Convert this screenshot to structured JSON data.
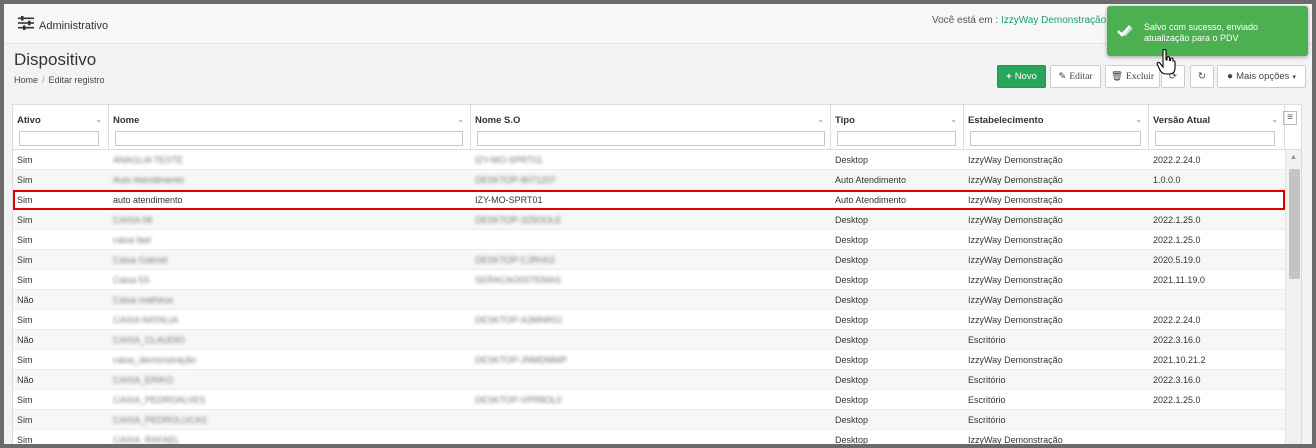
{
  "header": {
    "app_title": "Administrativo",
    "where_label": "Você está em :",
    "where_value": "IzzyWay Demonstração"
  },
  "page": {
    "title": "Dispositivo",
    "breadcrumb_home": "Home",
    "breadcrumb_sep": "/",
    "breadcrumb_current": "Editar registro"
  },
  "toolbar": {
    "new_label": "Novo",
    "edit_label": "Editar",
    "delete_label": "Excluir",
    "more_label": "Mais opções"
  },
  "toast": {
    "message": "Salvo com sucesso, enviado atualização para o PDV",
    "color": "#4caf50"
  },
  "colors": {
    "accent": "#26a65b",
    "selection": "#e00000",
    "link": "#1a9e7a"
  },
  "table": {
    "columns": [
      "Ativo",
      "Nome",
      "Nome S.O",
      "Tipo",
      "Estabelecimento",
      "Versão Atual"
    ],
    "rows": [
      {
        "ativo": "Sim",
        "nome": "ANAGLIA TESTE",
        "so": "IZY-MO-SPRT01",
        "tipo": "Desktop",
        "estab": "IzzyWay Demonstração",
        "versao": "2022.2.24.0",
        "blur": true
      },
      {
        "ativo": "Sim",
        "nome": "Auto Atendimento",
        "so": "DESKTOP-8071207",
        "tipo": "Auto Atendimento",
        "estab": "IzzyWay Demonstração",
        "versao": "1.0.0.0",
        "blur": true
      },
      {
        "ativo": "Sim",
        "nome": "auto atendimento",
        "so": "IZY-MO-SPRT01",
        "tipo": "Auto Atendimento",
        "estab": "IzzyWay Demonstração",
        "versao": "",
        "blur": false,
        "selected": true
      },
      {
        "ativo": "Sim",
        "nome": "CAIXA 08",
        "so": "DESKTOP-3Z5OOLE",
        "tipo": "Desktop",
        "estab": "IzzyWay Demonstração",
        "versao": "2022.1.25.0",
        "blur": true
      },
      {
        "ativo": "Sim",
        "nome": "caixa fael",
        "so": "",
        "tipo": "Desktop",
        "estab": "IzzyWay Demonstração",
        "versao": "2022.1.25.0",
        "blur": true
      },
      {
        "ativo": "Sim",
        "nome": "Caixa Gabriel",
        "so": "DESKTOP-CJRH02",
        "tipo": "Desktop",
        "estab": "IzzyWay Demonstração",
        "versao": "2020.5.19.0",
        "blur": true
      },
      {
        "ativo": "Sim",
        "nome": "Caixa 5S",
        "so": "SERACAO0STEMAS",
        "tipo": "Desktop",
        "estab": "IzzyWay Demonstração",
        "versao": "2021.11.19.0",
        "blur": true
      },
      {
        "ativo": "Não",
        "nome": "Caixa matheus",
        "so": "",
        "tipo": "Desktop",
        "estab": "IzzyWay Demonstração",
        "versao": "",
        "blur": true
      },
      {
        "ativo": "Sim",
        "nome": "CAIXA NATALIA",
        "so": "DESKTOP-A3MNR0J",
        "tipo": "Desktop",
        "estab": "IzzyWay Demonstração",
        "versao": "2022.2.24.0",
        "blur": true
      },
      {
        "ativo": "Não",
        "nome": "CAIXA_CLAUDIO",
        "so": "",
        "tipo": "Desktop",
        "estab": "Escritório",
        "versao": "2022.3.16.0",
        "blur": true
      },
      {
        "ativo": "Sim",
        "nome": "caixa_demonstração",
        "so": "DESKTOP-JNMDMMP",
        "tipo": "Desktop",
        "estab": "IzzyWay Demonstração",
        "versao": "2021.10.21.2",
        "blur": true
      },
      {
        "ativo": "Não",
        "nome": "CAIXA_ERIKO",
        "so": "",
        "tipo": "Desktop",
        "estab": "Escritório",
        "versao": "2022.3.16.0",
        "blur": true
      },
      {
        "ativo": "Sim",
        "nome": "CAIXA_PEDROALVES",
        "so": "DESKTOP-VPR8OL0",
        "tipo": "Desktop",
        "estab": "Escritório",
        "versao": "2022.1.25.0",
        "blur": true
      },
      {
        "ativo": "Sim",
        "nome": "CAIXA_PEDROLUCAS",
        "so": "",
        "tipo": "Desktop",
        "estab": "Escritório",
        "versao": "",
        "blur": true
      },
      {
        "ativo": "Sim",
        "nome": "CAIXA_RAFAEL",
        "so": "",
        "tipo": "Desktop",
        "estab": "IzzyWay Demonstração",
        "versao": "",
        "blur": true
      }
    ]
  }
}
